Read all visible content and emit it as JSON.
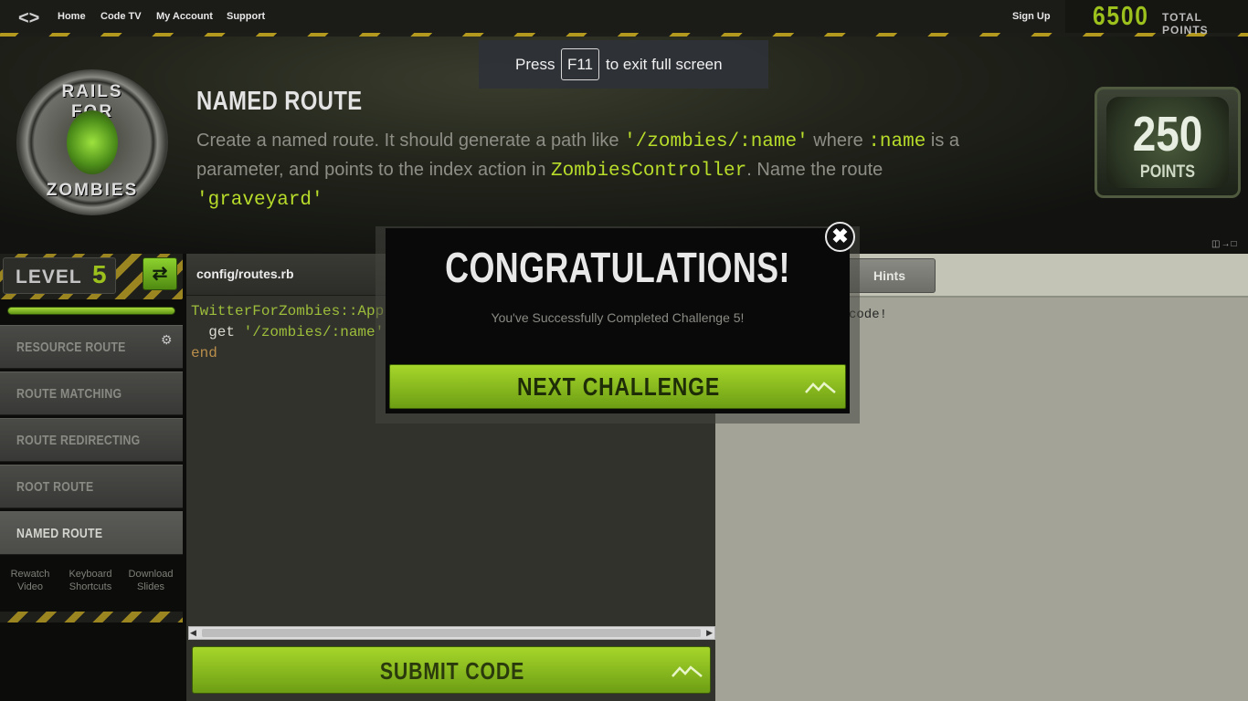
{
  "nav": {
    "home": "Home",
    "code_tv": "Code TV",
    "my_account": "My Account",
    "support": "Support",
    "sign_up": "Sign Up"
  },
  "points": {
    "total": "6500",
    "label": "TOTAL POINTS"
  },
  "course": {
    "badge_top": "RAILS FOR",
    "badge_bottom": "ZOMBIES"
  },
  "fullscreen": {
    "press": "Press",
    "key": "F11",
    "rest": "to exit full screen"
  },
  "challenge": {
    "title": "NAMED ROUTE",
    "desc_1": "Create a named route. It should generate a path like ",
    "code_1": "'/zombies/:name'",
    "desc_2": " where ",
    "code_2": ":name",
    "desc_3": " is a parameter, and points to the index action in ",
    "code_3": "ZombiesController",
    "desc_4": ". Name the route ",
    "code_4": "'graveyard'"
  },
  "tv": {
    "value": "250",
    "label": "POINTS"
  },
  "sidebar": {
    "level_label": "LEVEL",
    "level_num": "5",
    "switch_icon": "swap-arrows-icon",
    "progress": 1.0,
    "items": [
      {
        "label": "RESOURCE ROUTE"
      },
      {
        "label": "ROUTE MATCHING"
      },
      {
        "label": "ROUTE REDIRECTING"
      },
      {
        "label": "ROOT ROUTE"
      },
      {
        "label": "NAMED ROUTE"
      }
    ],
    "links": [
      {
        "line1": "Rewatch",
        "line2": "Video"
      },
      {
        "line1": "Keyboard",
        "line2": "Shortcuts"
      },
      {
        "line1": "Download",
        "line2": "Slides"
      }
    ]
  },
  "editor": {
    "filename": "config/routes.rb",
    "line1": "TwitterForZombies::App",
    "line2_prefix": "  get ",
    "line2_str": "'/zombies/:name'",
    "line3": "end",
    "submit_label": "SUBMIT CODE"
  },
  "right_panel": {
    "hints_tab": "Hints",
    "output": "code!"
  },
  "modal": {
    "title": "CONGRATULATIONS!",
    "subtitle": "You've Successfully Completed Challenge 5!",
    "next_label": "NEXT CHALLENGE",
    "close_icon": "close-icon"
  },
  "colors": {
    "accent": "#9cc11d",
    "button": "#a6d62a",
    "stripe": "#b39a1e"
  }
}
